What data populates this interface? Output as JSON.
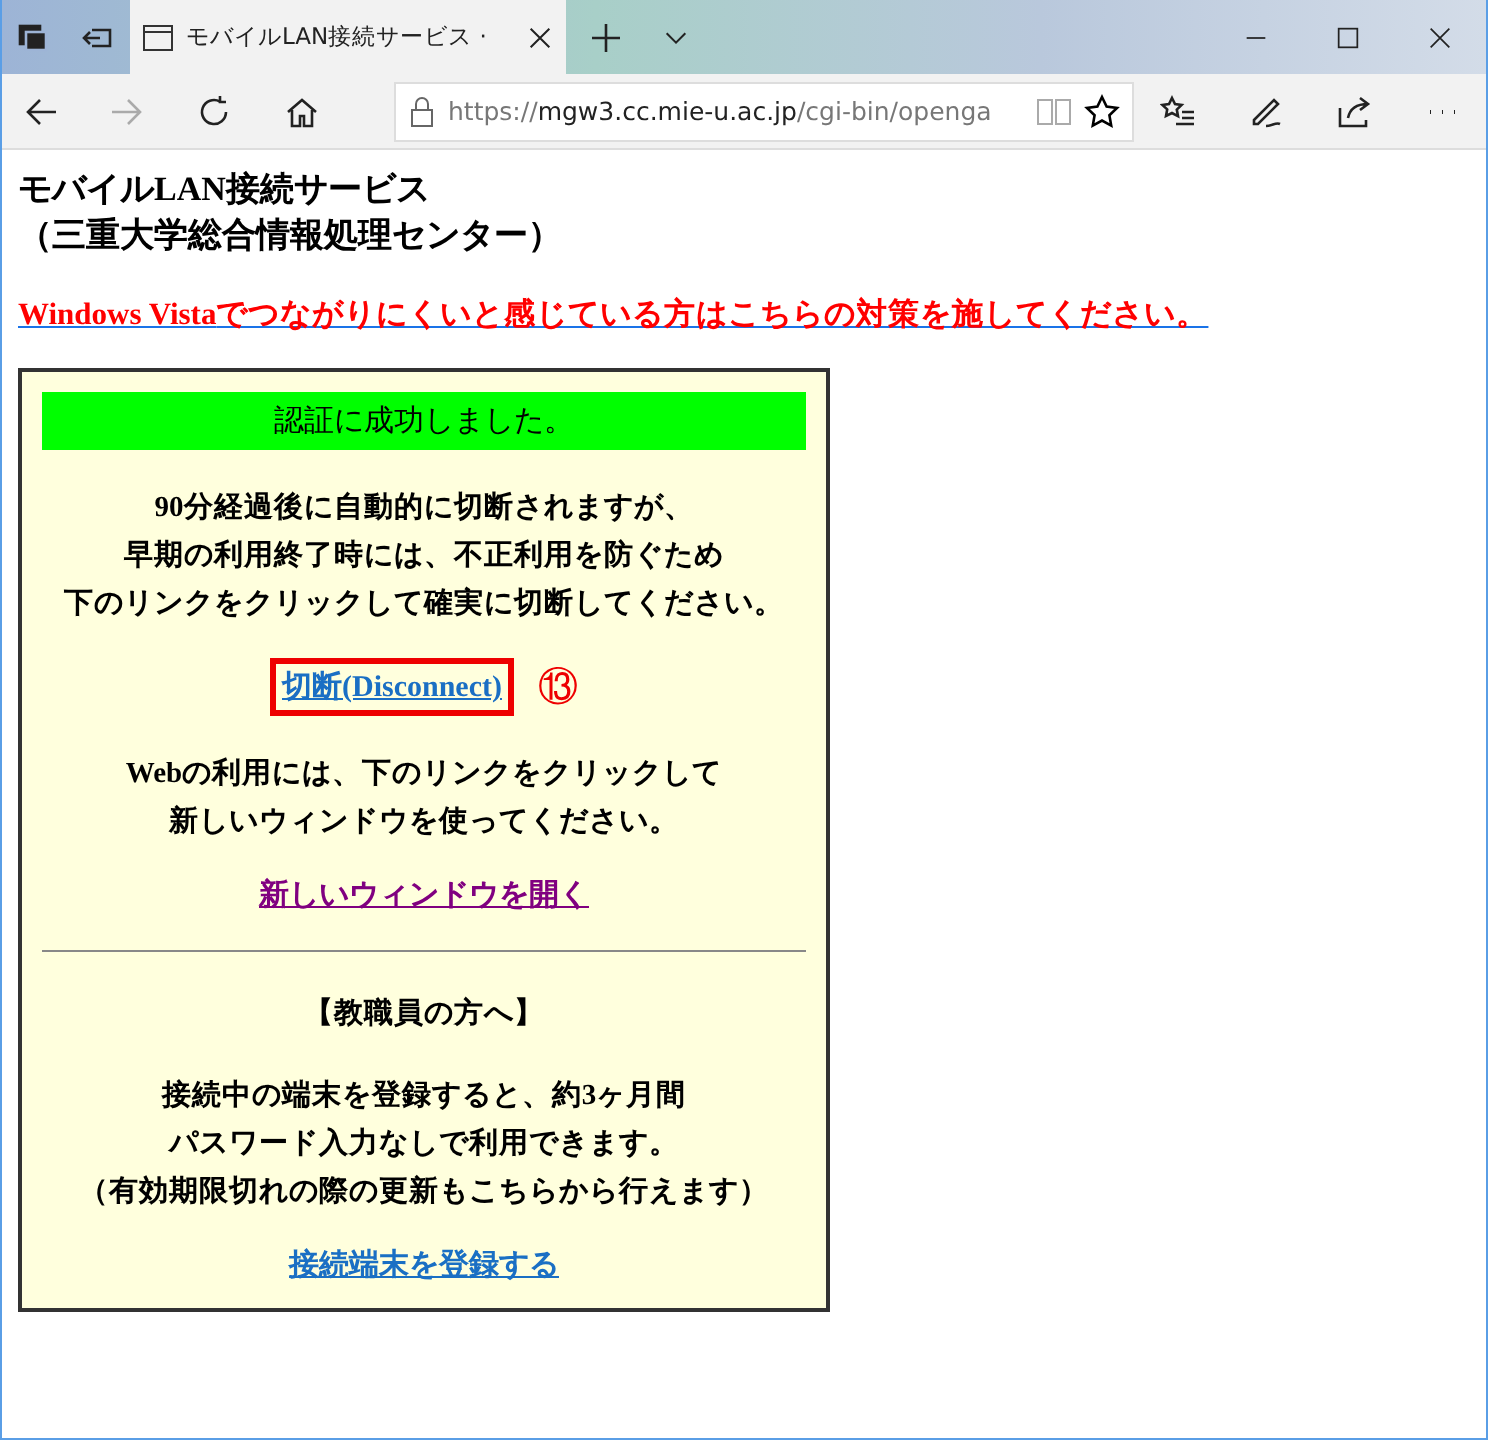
{
  "browser": {
    "tab": {
      "title": "モバイルLAN接続サービス ·",
      "selected": true
    },
    "address": {
      "scheme": "https://",
      "host": "mgw3.cc.mie-u.ac.jp",
      "path": "/cgi-bin/openga"
    },
    "forward_disabled": true
  },
  "page": {
    "heading": [
      "モバイルLAN接続サービス",
      "（三重大学総合情報処理センター）"
    ],
    "notice_link": "**Windows Vista**でつながりにくいと感じている方はこちらの対策を施してください。",
    "panel": {
      "status": "認証に成功しました。",
      "sections": [
        {
          "kind": "text",
          "lines": [
            "90分経過後に自動的に切断されますが、",
            "早期の利用終了時には、不正利用を防ぐため",
            "下のリンクをクリックして確実に切断してください。"
          ]
        },
        {
          "kind": "link",
          "label": "切断(Disconnect)",
          "visited": false,
          "highlighted": true,
          "callout": "⑬"
        },
        {
          "kind": "text",
          "lines": [
            "Webの利用には、下のリンクをクリックして",
            "新しいウィンドウを使ってください。"
          ]
        },
        {
          "kind": "link",
          "label": "新しいウィンドウを開く",
          "visited": true,
          "highlighted": false
        },
        {
          "kind": "rule"
        },
        {
          "kind": "text",
          "lines": [
            "【教職員の方へ】"
          ]
        },
        {
          "kind": "text",
          "lines": [
            "接続中の端末を登録すると、約3ヶ月間",
            "パスワード入力なしで利用できます。",
            "（有効期限切れの際の更新もこちらから行えます）"
          ]
        },
        {
          "kind": "link",
          "label": "接続端末を登録する",
          "visited": false,
          "highlighted": false
        }
      ]
    }
  }
}
